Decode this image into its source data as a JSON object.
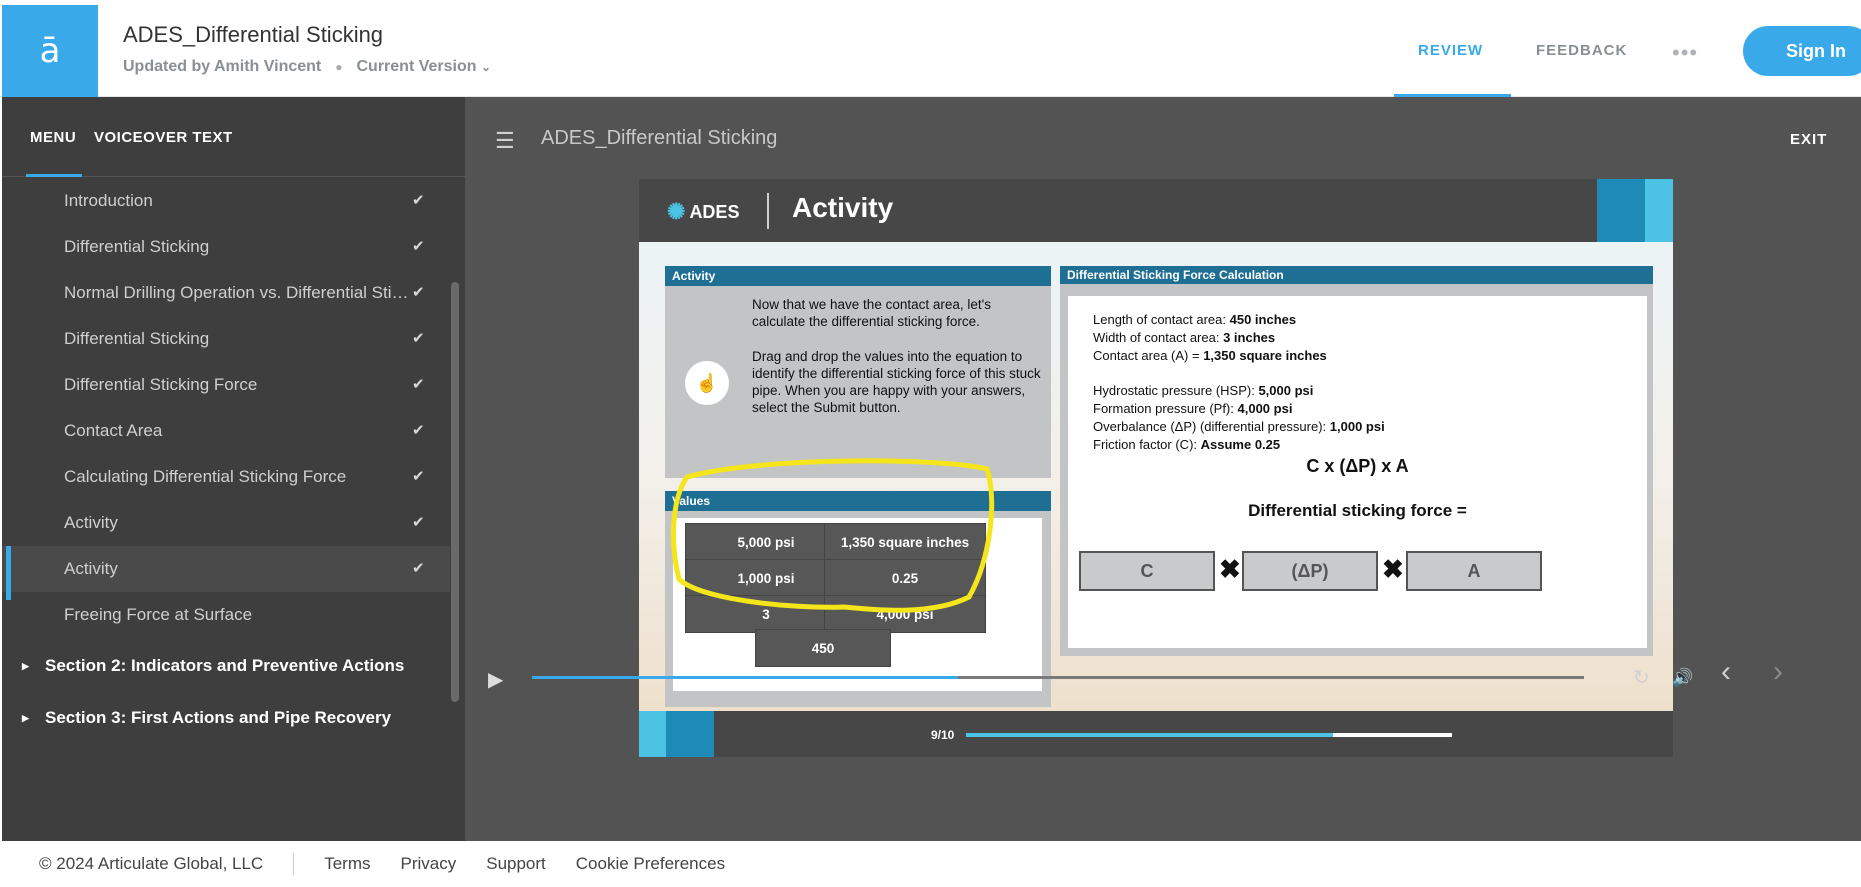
{
  "brand": {
    "logo_glyph": "ā",
    "accent": "#3aa9e9"
  },
  "header": {
    "title": "ADES_Differential Sticking",
    "updated_by": "Updated by Amith Vincent",
    "version_label": "Current Version",
    "tabs": [
      "REVIEW",
      "FEEDBACK"
    ],
    "more_glyph": "•••",
    "sign_in_label": "Sign In"
  },
  "sidebar": {
    "tabs": [
      "MENU",
      "VOICEOVER TEXT"
    ],
    "items": [
      {
        "label": "Introduction",
        "done": true
      },
      {
        "label": "Differential Sticking",
        "done": true
      },
      {
        "label": "Normal Drilling Operation vs. Differential Sticking",
        "done": true
      },
      {
        "label": "Differential Sticking",
        "done": true
      },
      {
        "label": "Differential Sticking Force",
        "done": true
      },
      {
        "label": "Contact Area",
        "done": true
      },
      {
        "label": "Calculating Differential Sticking Force",
        "done": true
      },
      {
        "label": "Activity",
        "done": true
      },
      {
        "label": "Activity",
        "done": true,
        "active": true
      },
      {
        "label": "Freeing Force at Surface",
        "done": false
      }
    ],
    "sections": [
      "Section 2: Indicators and Preventive Actions",
      "Section 3: First Actions and Pipe Recovery"
    ],
    "check_glyph": "✔",
    "caret_glyph": "▶"
  },
  "player": {
    "menu_glyph": "☰",
    "title": "ADES_Differential Sticking",
    "exit_label": "EXIT",
    "seek_progress": 0.405
  },
  "slide": {
    "logo_text": "ADES",
    "title": "Activity",
    "activity": {
      "header": "Activity",
      "text1": "Now that we have the contact area, let's calculate the differential sticking force.",
      "text2": "Drag and drop the values into the equation to identify the differential sticking force of this stuck pipe. When you are happy with your answers, select the Submit button."
    },
    "values": {
      "header": "Values",
      "tiles": [
        "5,000 psi",
        "1,350 square inches",
        "1,000 psi",
        "0.25",
        "3",
        "4,000 psi",
        "450"
      ]
    },
    "calc": {
      "header": "Differential Sticking Force Calculation",
      "facts": [
        {
          "label": "Length of contact area: ",
          "value": "450 inches"
        },
        {
          "label": "Width of contact area: ",
          "value": "3 inches"
        },
        {
          "label": "Contact area (A) = ",
          "value": "1,350 square inches"
        },
        {
          "label": "Hydrostatic pressure (HSP): ",
          "value": "5,000 psi"
        },
        {
          "label": "Formation pressure (Pf): ",
          "value": "4,000 psi"
        },
        {
          "label": "Overbalance (ΔP) (differential pressure): ",
          "value": "1,000 psi"
        },
        {
          "label": "Friction factor (C): ",
          "value": "Assume 0.25"
        }
      ],
      "formula": "C x (ΔP) x A",
      "result_label": "Differential sticking force =",
      "slots": [
        "C",
        "(ΔP)",
        "A"
      ],
      "times_glyph": "✖"
    },
    "footer": {
      "page": "9/10",
      "progress": 0.755
    },
    "highlight_color": "#f5e51b"
  },
  "controls": {
    "play_glyph": "▶",
    "replay_glyph": "↻",
    "volume_glyph": "🔊",
    "prev_glyph": "‹",
    "next_glyph": "›"
  },
  "footer": {
    "copyright": "© 2024 Articulate Global, LLC",
    "links": [
      "Terms",
      "Privacy",
      "Support",
      "Cookie Preferences"
    ]
  }
}
